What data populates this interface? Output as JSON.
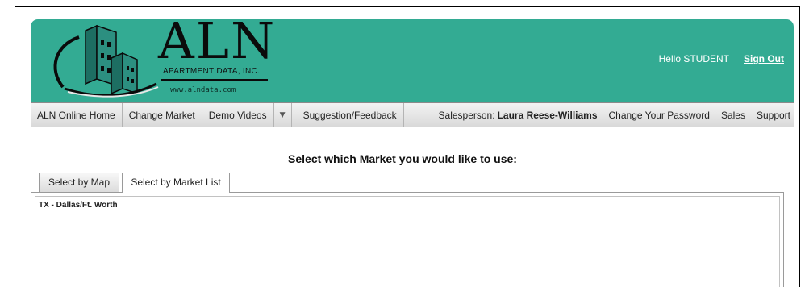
{
  "header": {
    "logo": {
      "title": "ALN",
      "subtitle": "APARTMENT DATA, INC.",
      "url": "www.alndata.com"
    },
    "greeting": "Hello STUDENT",
    "sign_out": "Sign Out",
    "bg_color": "#33ab93"
  },
  "navbar": {
    "items": [
      {
        "label": "ALN Online Home"
      },
      {
        "label": "Change Market"
      },
      {
        "label": "Demo Videos"
      },
      {
        "label": "Suggestion/Feedback"
      }
    ],
    "salesperson_label": "Salesperson:",
    "salesperson_name": "Laura Reese-Williams",
    "right_links": [
      {
        "label": "Change Your Password"
      },
      {
        "label": "Sales"
      },
      {
        "label": "Support"
      }
    ]
  },
  "main": {
    "title": "Select which Market you would like to use:",
    "tabs": [
      {
        "label": "Select by Map",
        "active": false
      },
      {
        "label": "Select by Market List",
        "active": true
      }
    ],
    "markets": [
      {
        "label": "TX - Dallas/Ft. Worth"
      }
    ]
  }
}
